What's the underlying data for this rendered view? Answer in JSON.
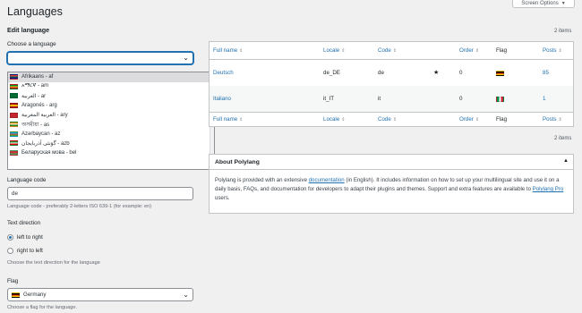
{
  "header": {
    "title": "Languages",
    "screen_options": "Screen Options"
  },
  "form": {
    "section_title": "Edit language",
    "choose_label": "Choose a language",
    "choose_value": "",
    "dropdown_items": [
      {
        "label": "Afrikaans - af",
        "flag": "za"
      },
      {
        "label": "አማርኛ - am",
        "flag": "et"
      },
      {
        "label": "العربية - ar",
        "flag": "arab"
      },
      {
        "label": "Aragonés - arg",
        "flag": "es"
      },
      {
        "label": "العربية المغربية - ary",
        "flag": "ma"
      },
      {
        "label": "অসমীয়া - as",
        "flag": "in"
      },
      {
        "label": "Azərbaycan - az",
        "flag": "az"
      },
      {
        "label": "گؤنئی آذربایجان - azb",
        "flag": "ir"
      },
      {
        "label": "Беларуская мова - bel",
        "flag": "by"
      }
    ],
    "code_label": "Language code",
    "code_value": "de",
    "code_help": "Language code - preferably 2-letters ISO 639-1 (for example: en)",
    "direction_label": "Text direction",
    "ltr_label": "left to right",
    "rtl_label": "right to left",
    "direction_help": "Choose the text direction for the language",
    "flag_label": "Flag",
    "flag_value": "Germany",
    "flag_help": "Choose a flag for the language."
  },
  "table": {
    "count_top": "2 items",
    "count_bottom": "2 items",
    "columns": [
      "Full name",
      "Locale",
      "Code",
      "Order",
      "Flag",
      "Posts"
    ],
    "rows": [
      {
        "name": "Deutsch",
        "locale": "de_DE",
        "code": "de",
        "default": "★",
        "order": "0",
        "flag": "de",
        "posts": "85"
      },
      {
        "name": "Italiano",
        "locale": "it_IT",
        "code": "it",
        "default": "",
        "order": "0",
        "flag": "it",
        "posts": "1"
      }
    ]
  },
  "about": {
    "title": "About Polylang",
    "text_1": "Polylang is provided with an extensive ",
    "link_1": "documentation",
    "text_2": " (in English). It includes information on how to set up your multilingual site and use it on a daily basis, FAQs, and documentation for developers to adapt their plugins and themes. Support and extra features are available to ",
    "link_2": "Polylang Pro",
    "text_3": " users."
  },
  "colors": {
    "accent": "#2271b1",
    "background": "#f0f0f1"
  }
}
